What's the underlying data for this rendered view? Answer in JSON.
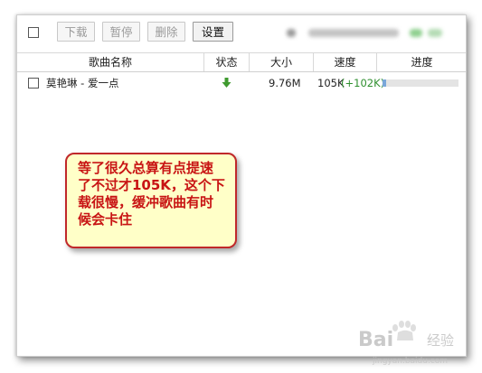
{
  "toolbar": {
    "download_label": "下载",
    "pause_label": "暂停",
    "delete_label": "删除",
    "settings_label": "设置"
  },
  "table": {
    "columns": [
      "歌曲名称",
      "状态",
      "大小",
      "速度",
      "进度"
    ],
    "rows": [
      {
        "name": "莫艳琳 - 爱一点",
        "status_icon": "download-arrow-icon",
        "size": "9.76M",
        "speed": "105K",
        "speed_delta": "(+102K)",
        "progress_fraction": 0.05
      }
    ]
  },
  "callout": {
    "text": "等了很久总算有点提速了不过才105K，这个下载很慢，缓冲歌曲有时候会卡住"
  },
  "watermark": {
    "brand": "Bai",
    "brand_suffix": "经验",
    "url": "jingyan.baidu.com"
  },
  "colors": {
    "callout_border": "#c0282a",
    "callout_bg": "#ffffc8",
    "callout_text": "#c81414",
    "status_arrow": "#3f9a2f",
    "speed_delta": "#2f8f2f",
    "progress_fill": "#7aa7d9"
  }
}
